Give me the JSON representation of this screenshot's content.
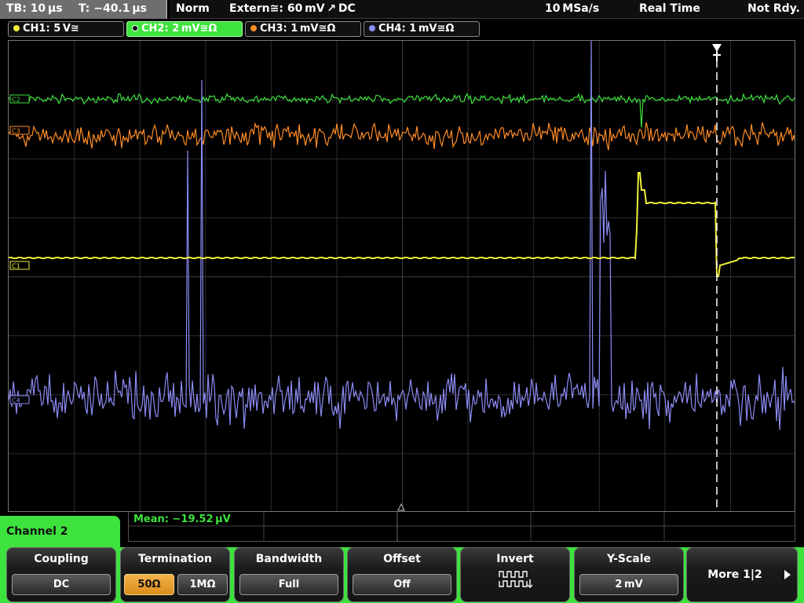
{
  "topbar": {
    "timebase": "TB: 10 µs",
    "trigger_pos": "T: −40.1 µs",
    "mode": "Norm",
    "trigger": "Extern≅: 60 mV ↗ DC",
    "sample_rate": "10 MSa/s",
    "acq_mode": "Real Time",
    "status": "Not Rdy."
  },
  "channels": [
    {
      "label": "CH1: 5 V≅",
      "color": "#f2f23a",
      "active": false
    },
    {
      "label": "CH2: 2 mV≅Ω",
      "color": "#3de23d",
      "active": true
    },
    {
      "label": "CH3: 1 mV≅Ω",
      "color": "#ff8c26",
      "active": false
    },
    {
      "label": "CH4: 1 mV≅Ω",
      "color": "#8c8cf5",
      "active": false
    }
  ],
  "markers": {
    "ch1": "C1",
    "ch2": "C2",
    "ch3": "C3",
    "ch4": "C4"
  },
  "measurement": {
    "mean": "Mean: −19.52 µV"
  },
  "menu": {
    "channel_label": "Channel 2",
    "coupling": {
      "title": "Coupling",
      "value": "DC"
    },
    "termination": {
      "title": "Termination",
      "options": [
        "50Ω",
        "1MΩ"
      ],
      "selected": "50Ω"
    },
    "bandwidth": {
      "title": "Bandwidth",
      "value": "Full"
    },
    "offset": {
      "title": "Offset",
      "value": "Off"
    },
    "invert": {
      "title": "Invert",
      "icon": "invert-waveform-icon"
    },
    "yscale": {
      "title": "Y-Scale",
      "value": "2 mV"
    },
    "more": {
      "label": "More 1|2"
    }
  },
  "colors": {
    "ch1": "#f2f23a",
    "ch2": "#3de23d",
    "ch3": "#ff8c26",
    "ch4": "#8c8cf5",
    "menu_accent": "#3de23d",
    "selected_option": "#f0a030"
  }
}
